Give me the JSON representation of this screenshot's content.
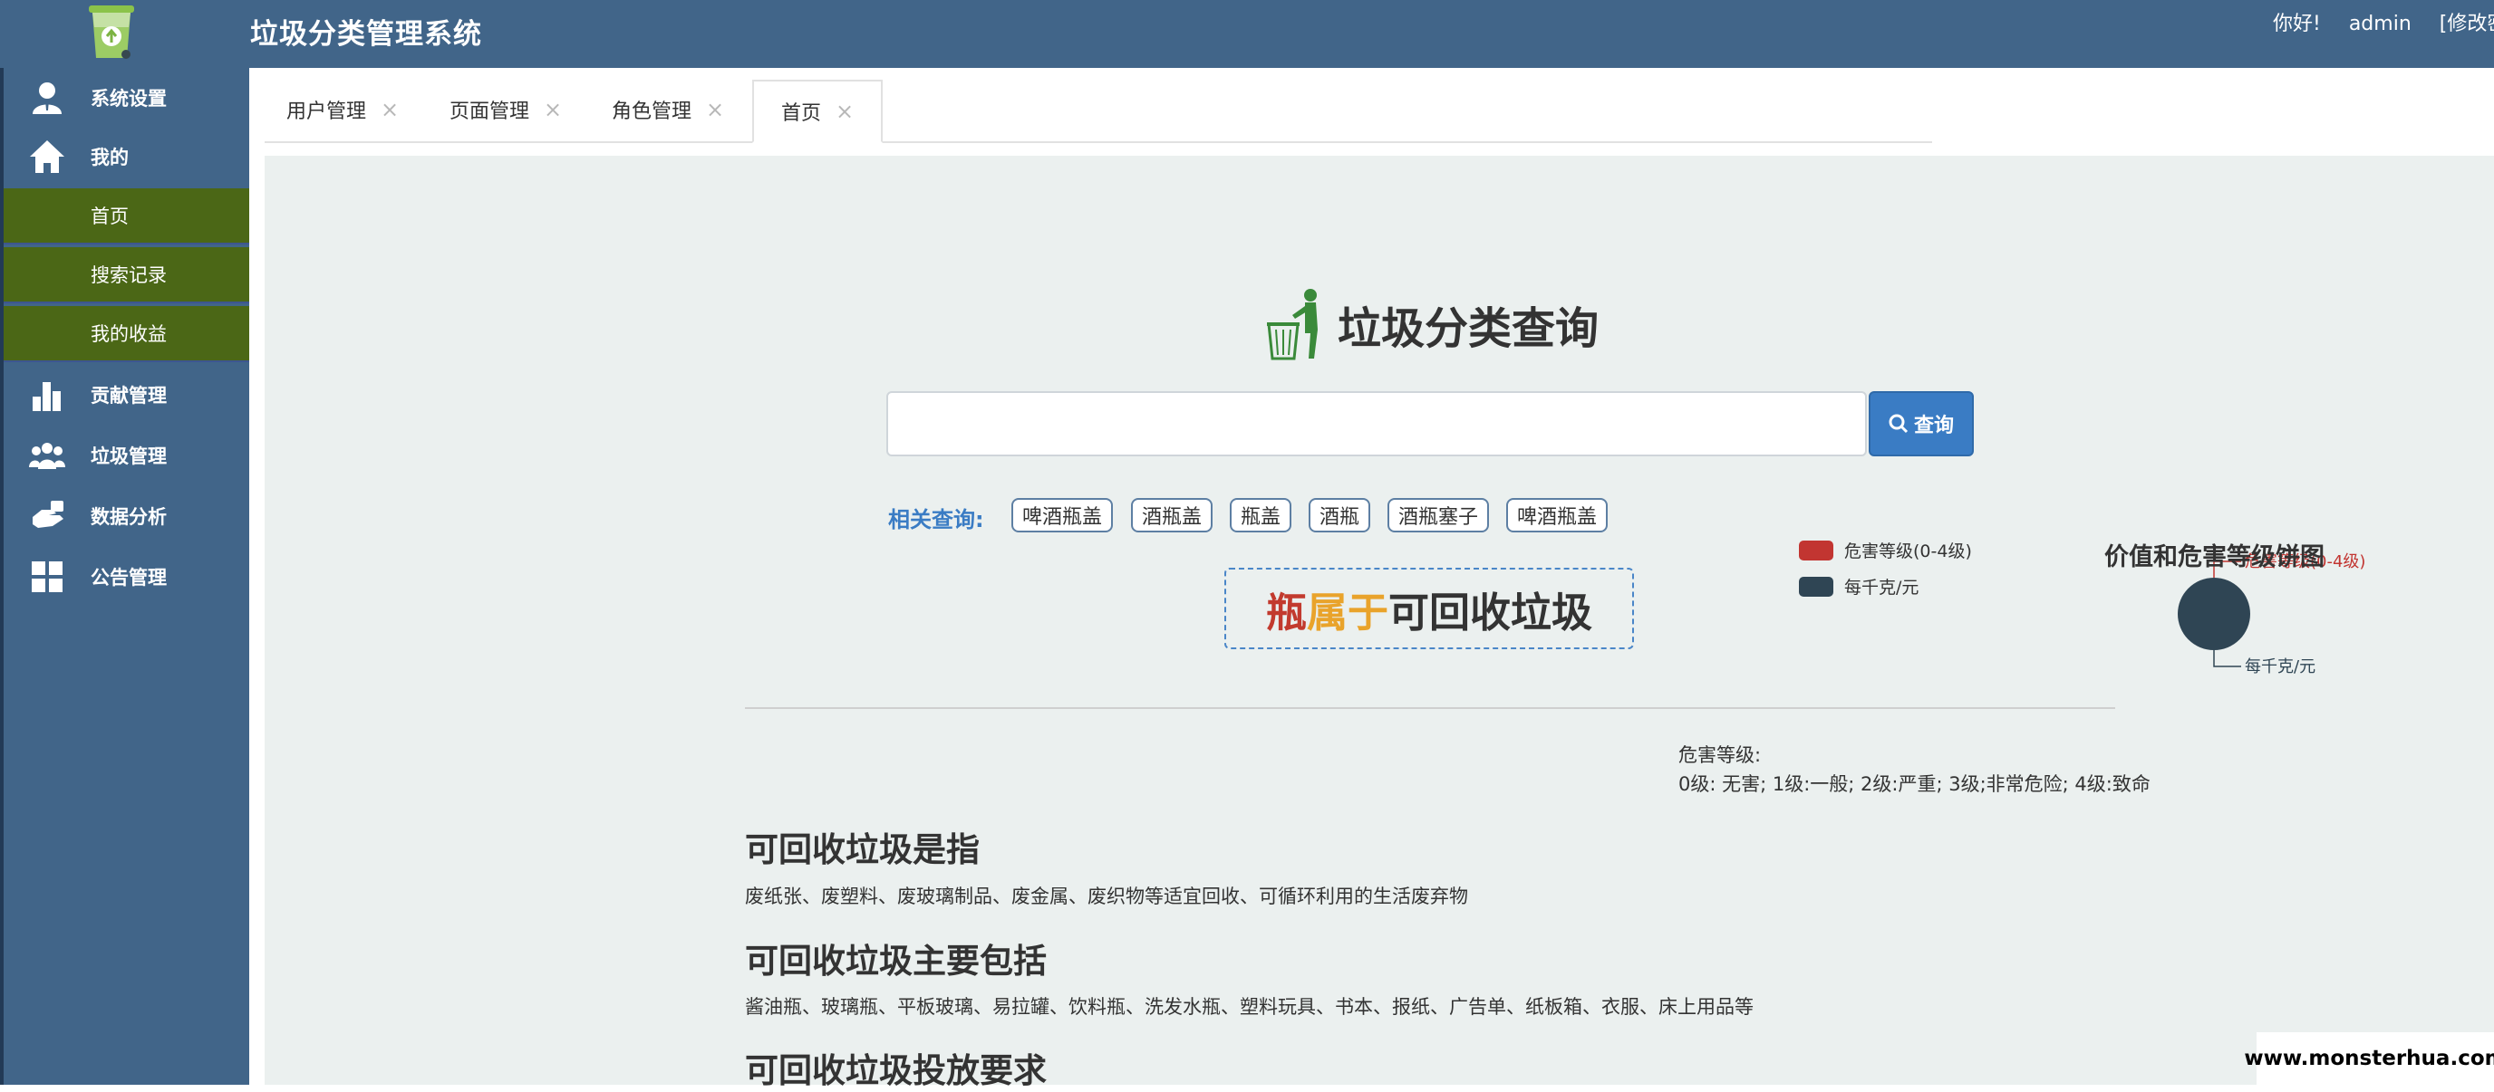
{
  "header": {
    "title": "垃圾分类管理系统",
    "greeting": "你好!",
    "username": "admin",
    "change_password": "[修改密码"
  },
  "sidebar": {
    "items": [
      {
        "label": "系统设置",
        "icon": "user-icon"
      },
      {
        "label": "我的",
        "icon": "home-icon"
      },
      {
        "label": "首页",
        "sub": true
      },
      {
        "label": "搜索记录",
        "sub": true
      },
      {
        "label": "我的收益",
        "sub": true
      },
      {
        "label": "贡献管理",
        "icon": "bar-chart-icon"
      },
      {
        "label": "垃圾管理",
        "icon": "users-icon"
      },
      {
        "label": "数据分析",
        "icon": "hand-icon"
      },
      {
        "label": "公告管理",
        "icon": "grid-icon"
      }
    ]
  },
  "tabs": [
    {
      "label": "用户管理"
    },
    {
      "label": "页面管理"
    },
    {
      "label": "角色管理"
    },
    {
      "label": "首页",
      "active": true
    }
  ],
  "search": {
    "title": "垃圾分类查询",
    "placeholder": "",
    "value": "",
    "button_label": "查询"
  },
  "related": {
    "label": "相关查询:",
    "tags": [
      "啤酒瓶盖",
      "酒瓶盖",
      "瓶盖",
      "酒瓶",
      "酒瓶塞子",
      "啤酒瓶盖"
    ]
  },
  "result": {
    "item": "瓶",
    "verb": "属于",
    "category": "可回收垃圾"
  },
  "chart_data": {
    "type": "pie",
    "title": "价值和危害等级饼图",
    "legend": [
      "危害等级(0-4级)",
      "每千克/元"
    ],
    "legend_placement": "top-left",
    "labels": [
      "危害等级(0-4级)",
      "每千克/元"
    ],
    "colors": [
      "#c23531",
      "#2f4554"
    ],
    "values": [
      0,
      1
    ]
  },
  "hazard_note": {
    "title": "危害等级:",
    "levels": "0级: 无害; 1级:一般; 2级:严重; 3级;非常危险; 4级:致命"
  },
  "info": {
    "h1": "可回收垃圾是指",
    "p1": "废纸张、废塑料、废玻璃制品、废金属、废织物等适宜回收、可循环利用的生活废弃物",
    "h2": "可回收垃圾主要包括",
    "p2": "酱油瓶、玻璃瓶、平板玻璃、易拉罐、饮料瓶、洗发水瓶、塑料玩具、书本、报纸、广告单、纸板箱、衣服、床上用品等",
    "h3": "可回收垃圾投放要求"
  },
  "watermark": "www.monsterhua.com",
  "colors": {
    "header_bg": "#416589",
    "sub_menu_bg": "#4b6716",
    "content_bg": "#ebf0ef",
    "accent_blue": "#3a7cc4",
    "result_red": "#c23a2e",
    "result_orange": "#e9a32b"
  }
}
